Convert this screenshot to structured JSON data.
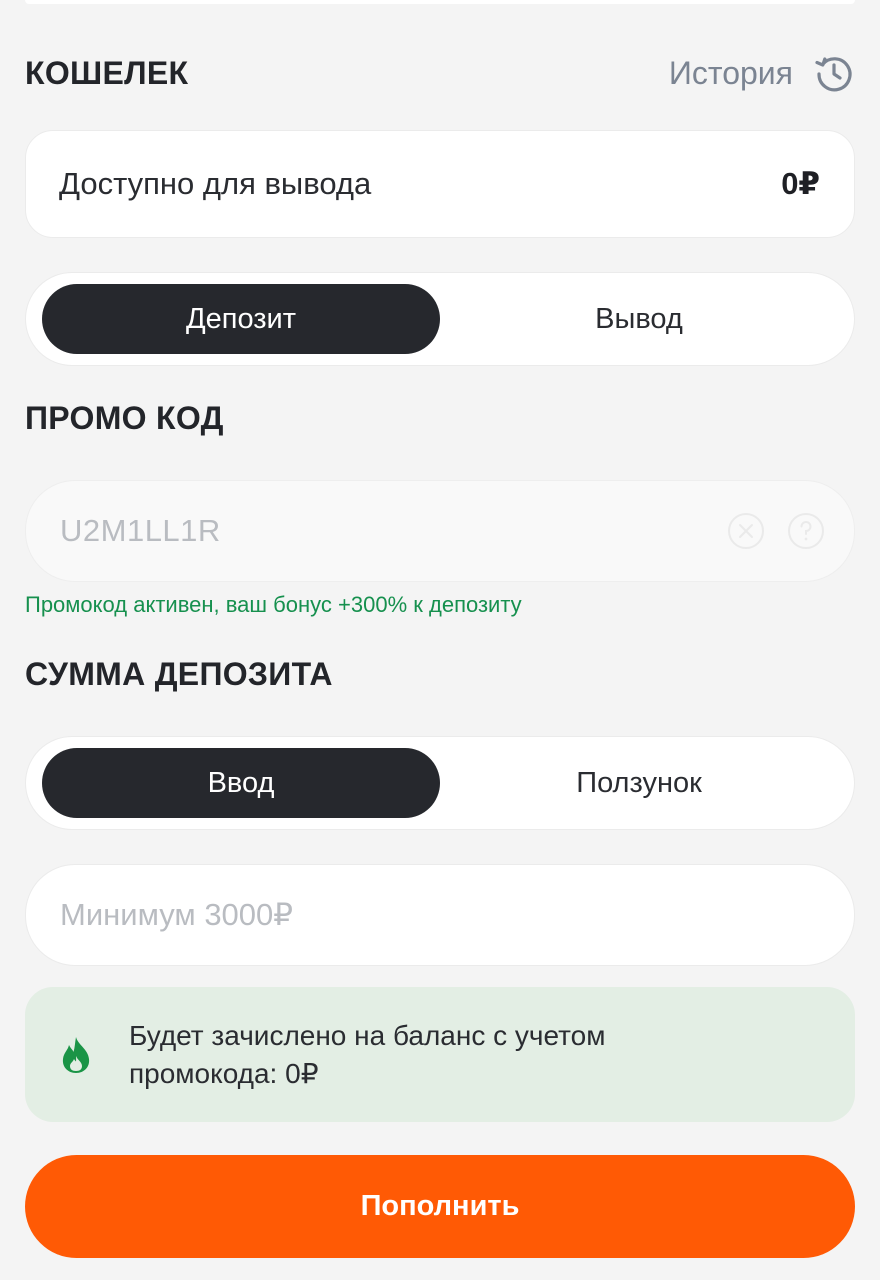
{
  "wallet": {
    "title": "КОШЕЛЕК",
    "history_label": "История",
    "history_icon": "history-clock-icon"
  },
  "balance": {
    "label": "Доступно для вывода",
    "value": "0₽"
  },
  "mode_tabs": {
    "deposit": "Депозит",
    "withdraw": "Вывод",
    "selected": "deposit"
  },
  "promo": {
    "title": "ПРОМО КОД",
    "value": "U2M1LL1R",
    "status": "Промокод активен, ваш бонус +300% к депозиту",
    "icons": [
      "clear-icon",
      "help-icon"
    ]
  },
  "deposit_sum": {
    "title": "СУММА ДЕПОЗИТА",
    "input_tab": "Ввод",
    "slider_tab": "Ползунок",
    "selected": "input",
    "placeholder": "Минимум 3000₽"
  },
  "info": {
    "icon": "flame-icon",
    "text_line1": "Будет зачислено на баланс с учетом",
    "text_line2": "промокода: 0₽"
  },
  "submit": {
    "label": "Пополнить"
  },
  "colors": {
    "accent": "#ff5a05",
    "success": "#16904e",
    "active_tab": "#26282d",
    "info_bg": "#e3eee4"
  }
}
